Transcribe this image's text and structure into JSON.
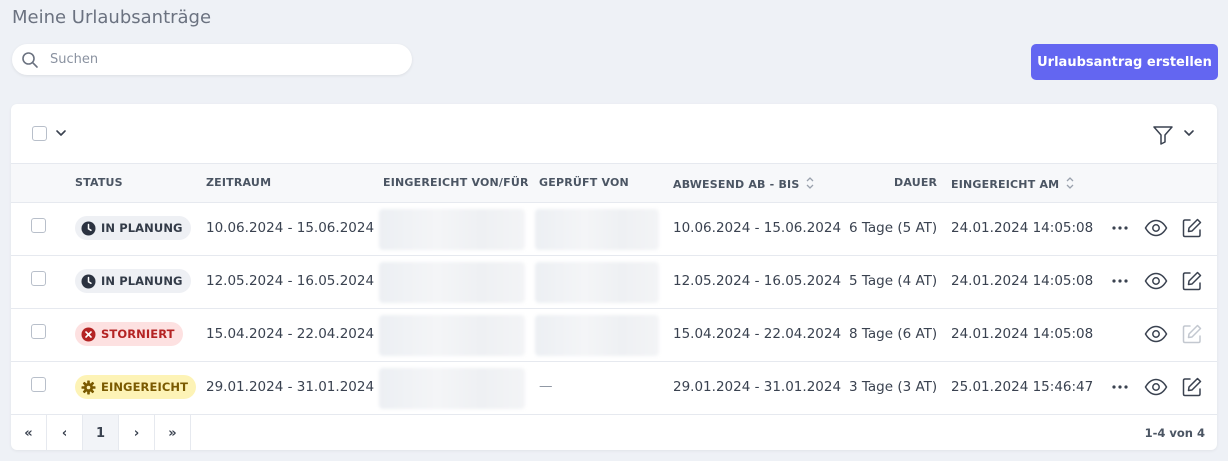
{
  "page": {
    "title": "Meine Urlaubsanträge"
  },
  "search": {
    "placeholder": "Suchen",
    "value": ""
  },
  "toolbar": {
    "create_label": "Urlaubsantrag erstellen"
  },
  "table": {
    "headers": {
      "status": "STATUS",
      "zeitraum": "ZEITRAUM",
      "eingereicht_von": "EINGEREICHT VON/FÜR",
      "geprueft_von": "GEPRÜFT VON",
      "abwesend": "ABWESEND AB - BIS",
      "dauer": "DAUER",
      "eingereicht_am": "EINGEREICHT AM"
    },
    "rows": [
      {
        "status": "IN PLANUNG",
        "zeitraum": "10.06.2024 - 15.06.2024",
        "geprueft": "",
        "abwesend": "10.06.2024 - 15.06.2024",
        "dauer": "6 Tage (5 AT)",
        "eingereicht_am": "24.01.2024 14:05:08"
      },
      {
        "status": "IN PLANUNG",
        "zeitraum": "12.05.2024 - 16.05.2024",
        "geprueft": "",
        "abwesend": "12.05.2024 - 16.05.2024",
        "dauer": "5 Tage (4 AT)",
        "eingereicht_am": "24.01.2024 14:05:08"
      },
      {
        "status": "STORNIERT",
        "zeitraum": "15.04.2024 - 22.04.2024",
        "geprueft": "",
        "abwesend": "15.04.2024 - 22.04.2024",
        "dauer": "8 Tage (6 AT)",
        "eingereicht_am": "24.01.2024 14:05:08"
      },
      {
        "status": "EINGEREICHT",
        "zeitraum": "29.01.2024 - 31.01.2024",
        "geprueft": "—",
        "abwesend": "29.01.2024 - 31.01.2024",
        "dauer": "3 Tage (3 AT)",
        "eingereicht_am": "25.01.2024 15:46:47"
      }
    ]
  },
  "pagination": {
    "first": "«",
    "prev": "‹",
    "current": "1",
    "next": "›",
    "last": "»",
    "count": "1-4 von 4"
  },
  "colors": {
    "accent": "#6366f1",
    "planung_bg": "#eef0f4",
    "storno_bg": "#fde1e1",
    "storno_fg": "#c62828",
    "eingereicht_bg": "#fdf3b6",
    "eingereicht_fg": "#8a6400"
  },
  "icons": [
    "search-icon",
    "chevron-down-icon",
    "filter-icon",
    "sort-icon",
    "clock-icon",
    "cancel-icon",
    "gear-icon",
    "more-icon",
    "eye-icon",
    "edit-icon"
  ]
}
